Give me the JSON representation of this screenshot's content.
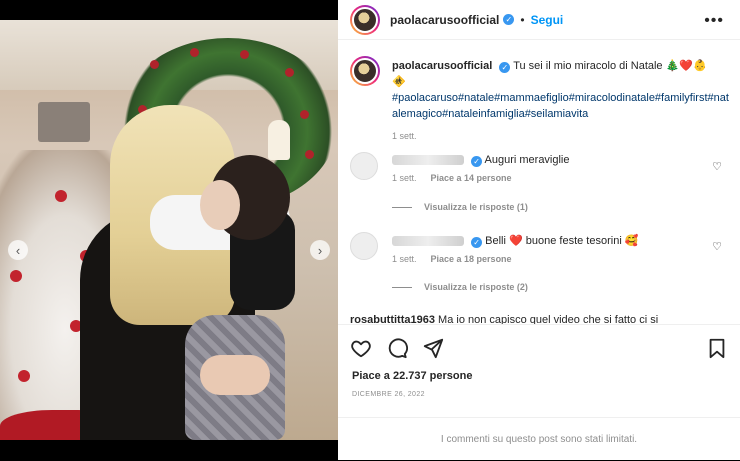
{
  "post": {
    "username": "paolacarusoofficial",
    "verified_icon": "verified-badge-icon",
    "separator": "•",
    "follow_label": "Segui",
    "more_icon": "more-options-icon",
    "more_glyph": "•••"
  },
  "caption": {
    "username": "paolacarusoofficial",
    "text": "Tu sei il mio miracolo di Natale 🎄❤️👶",
    "emoji_line2": "🚸",
    "hashtags": "#paolacaruso#natale#mammaefiglio#miracolodinatale#familyfirst#natalemagico#nataleinfamiglia#seilamiavita",
    "time": "1 sett."
  },
  "comments": [
    {
      "text": "Auguri meraviglie",
      "time": "1 sett.",
      "likes": "Piace a 14 persone",
      "replies": "Visualizza le risposte (1)"
    },
    {
      "text_before": "Belli",
      "heart": "❤️",
      "text_after": "buone feste tesorini 🥰",
      "time": "1 sett.",
      "likes": "Piace a 18 persone",
      "replies": "Visualizza le risposte (2)"
    }
  ],
  "partial_comment": {
    "username": "rosabuttitta1963",
    "text": "Ma io non capisco quel video che si fatto ci si"
  },
  "actions": {
    "like_icon": "heart-outline-icon",
    "comment_icon": "comment-bubble-icon",
    "share_icon": "paper-plane-icon",
    "save_icon": "bookmark-icon",
    "likes_text": "Piace a 22.737 persone",
    "date": "DICEMBRE 26, 2022",
    "limited_text": "I commenti su questo post sono stati limitati."
  },
  "media": {
    "prev_glyph": "‹",
    "next_glyph": "›",
    "carousel_dots": 3,
    "active_dot": 1
  },
  "colors": {
    "accent": "#0095f6",
    "text": "#262626",
    "muted": "#8e8e8e",
    "hashtag": "#00376b",
    "heart": "#ed4956"
  }
}
